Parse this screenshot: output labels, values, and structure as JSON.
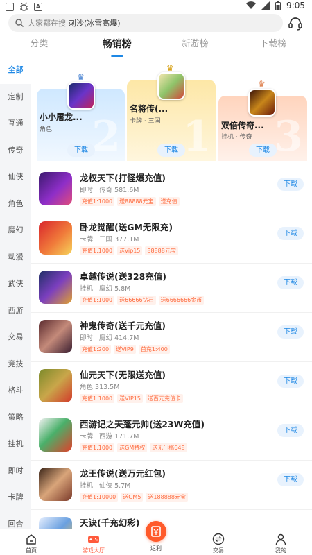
{
  "status_bar": {
    "time": "9:05",
    "left_icons": [
      "image-icon",
      "bug-icon",
      "a-icon"
    ]
  },
  "search": {
    "hint": "大家都在搜",
    "keyword": "刺沙(冰雪高爆)"
  },
  "tabs": [
    {
      "label": "分类",
      "active": false
    },
    {
      "label": "畅销榜",
      "active": true
    },
    {
      "label": "新游榜",
      "active": false
    },
    {
      "label": "下载榜",
      "active": false
    }
  ],
  "sidebar": [
    "全部",
    "定制",
    "互通",
    "传奇",
    "仙侠",
    "角色",
    "魔幻",
    "动漫",
    "武侠",
    "西游",
    "交易",
    "竞技",
    "格斗",
    "策略",
    "挂机",
    "即时",
    "卡牌",
    "回合"
  ],
  "podium": [
    {
      "rank": "2",
      "name": "小小屠龙...",
      "tags": "角色",
      "button": "下载"
    },
    {
      "rank": "1",
      "name": "名将传(...",
      "tags": "卡牌 · 三国",
      "button": "下载"
    },
    {
      "rank": "3",
      "name": "双倍传奇...",
      "tags": "挂机 · 传奇",
      "button": "下载"
    }
  ],
  "games": [
    {
      "title": "龙权天下(打怪爆充值)",
      "meta": "即时 · 传奇   581.6M",
      "tags": [
        "充值1:1000",
        "送88888元宝",
        "送充值"
      ],
      "button": "下载"
    },
    {
      "title": "卧龙觉醒(送GM无限充)",
      "meta": "卡牌 · 三国   377.1M",
      "tags": [
        "充值1:1000",
        "送vip15",
        "88888元宝"
      ],
      "button": "下载"
    },
    {
      "title": "卓越传说(送328充值)",
      "meta": "挂机 · 魔幻   5.8M",
      "tags": [
        "充值1:1000",
        "送66666钻石",
        "送6666666金币"
      ],
      "button": "下载"
    },
    {
      "title": "神鬼传奇(送千元充值)",
      "meta": "即时 · 魔幻   414.7M",
      "tags": [
        "充值1:200",
        "送VIP9",
        "首充1:400"
      ],
      "button": "下载"
    },
    {
      "title": "仙元天下(无限送充值)",
      "meta": "角色   313.5M",
      "tags": [
        "充值1:1000",
        "送VIP15",
        "送百元充值卡"
      ],
      "button": "下载"
    },
    {
      "title": "西游记之天蓬元帅(送23W充值)",
      "meta": "卡牌 · 西游   171.7M",
      "tags": [
        "充值1:1000",
        "送GM特权",
        "送无门槛648"
      ],
      "button": "下载"
    },
    {
      "title": "龙王传说(送万元红包)",
      "meta": "挂机 · 仙侠   5.7M",
      "tags": [
        "充值1:10000",
        "送GM5",
        "送188888元宝"
      ],
      "button": "下载"
    },
    {
      "title": "天诀(千充幻彩)",
      "meta": "",
      "tags": [],
      "button": ""
    }
  ],
  "bottom_nav": [
    {
      "label": "首页",
      "icon": "home-icon",
      "active": false
    },
    {
      "label": "游戏大厅",
      "icon": "gamepad-icon",
      "active": true
    },
    {
      "label": "返利",
      "icon": "rebate-icon",
      "active": false
    },
    {
      "label": "交易",
      "icon": "exchange-icon",
      "active": false
    },
    {
      "label": "我的",
      "icon": "user-icon",
      "active": false
    }
  ],
  "colors": {
    "accent": "#1e88e5",
    "tag": "#ff6a3d",
    "nav_active": "#ff5a3c"
  }
}
